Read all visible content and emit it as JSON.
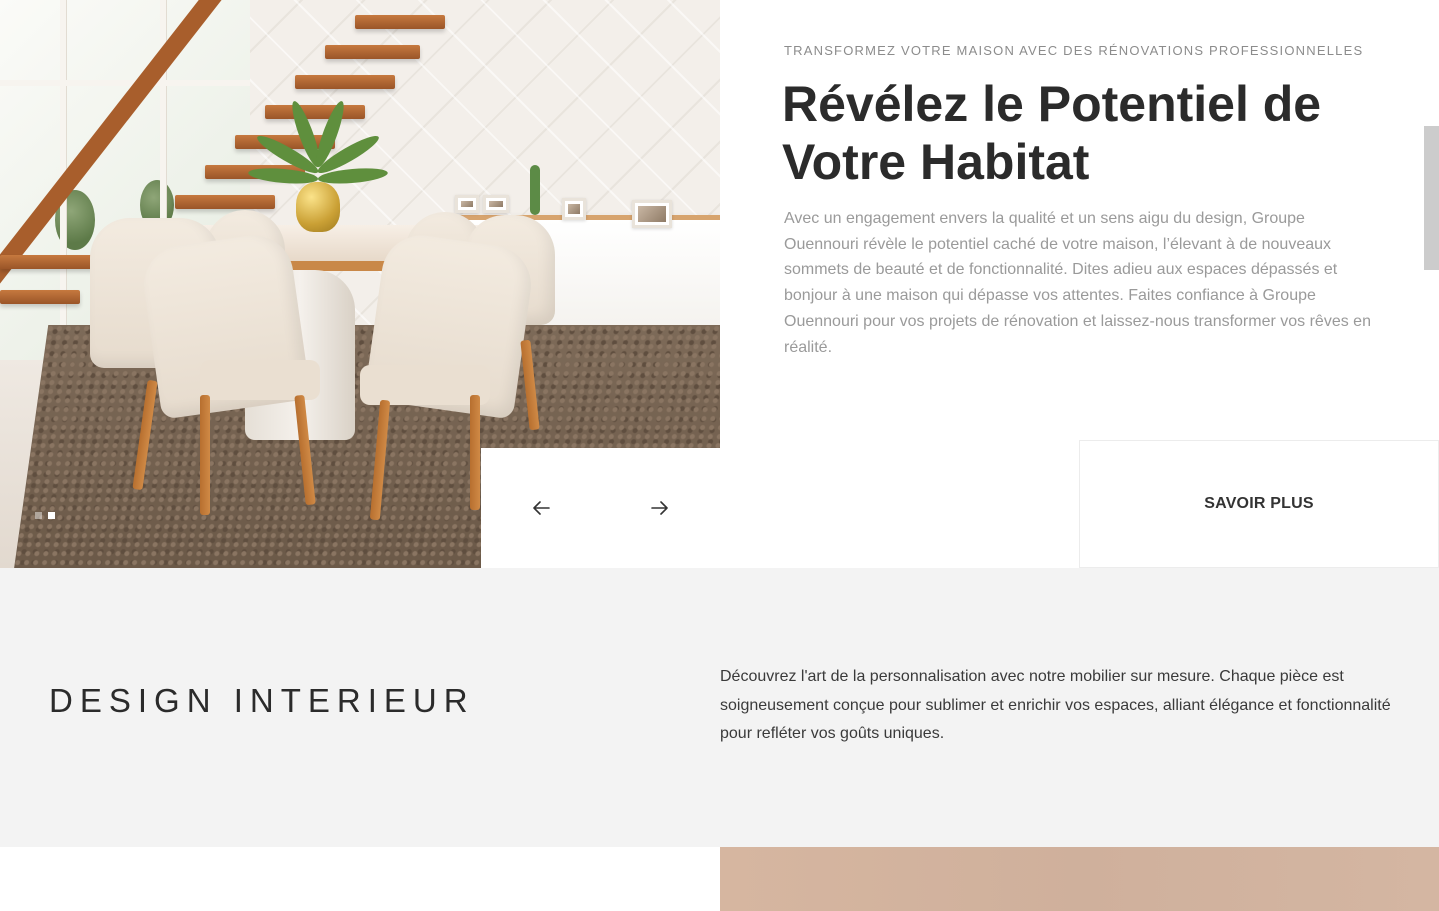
{
  "hero": {
    "eyebrow": "TRANSFORMEZ VOTRE MAISON AVEC DES RÉNOVATIONS PROFESSIONNELLES",
    "title_line1": "Révélez le Potentiel de",
    "title_line2": "Votre Habitat",
    "description": "Avec un engagement envers la qualité et un sens aigu du design, Groupe Ouennouri révèle le potentiel caché de votre maison, l’élevant à de nouveaux sommets de beauté et de fonctionnalité. Dites adieu aux espaces dépassés et bonjour à une maison qui dépasse vos attentes. Faites confiance à Groupe Ouennouri pour vos projets de rénovation et laissez-nous transformer vos rêves en réalité.",
    "image_icon": "dining-room-photo",
    "slides": {
      "count": 2,
      "active": 2
    }
  },
  "controls": {
    "prev_icon": "arrow-left-icon",
    "next_icon": "arrow-right-icon",
    "cta_label": "SAVOIR PLUS"
  },
  "design": {
    "title": "DESIGN INTERIEUR",
    "description": "Découvrez l'art de la personnalisation avec notre mobilier sur mesure. Chaque pièce est soigneusement conçue pour sublimer et enrichir vos espaces, alliant élégance et fonctionnalité pour refléter vos goûts uniques."
  },
  "colors": {
    "heading": "#2b2b2b",
    "body_text": "#9a9a9a",
    "section_bg": "#f3f3f3",
    "accent_image": "#d4b6a2"
  }
}
